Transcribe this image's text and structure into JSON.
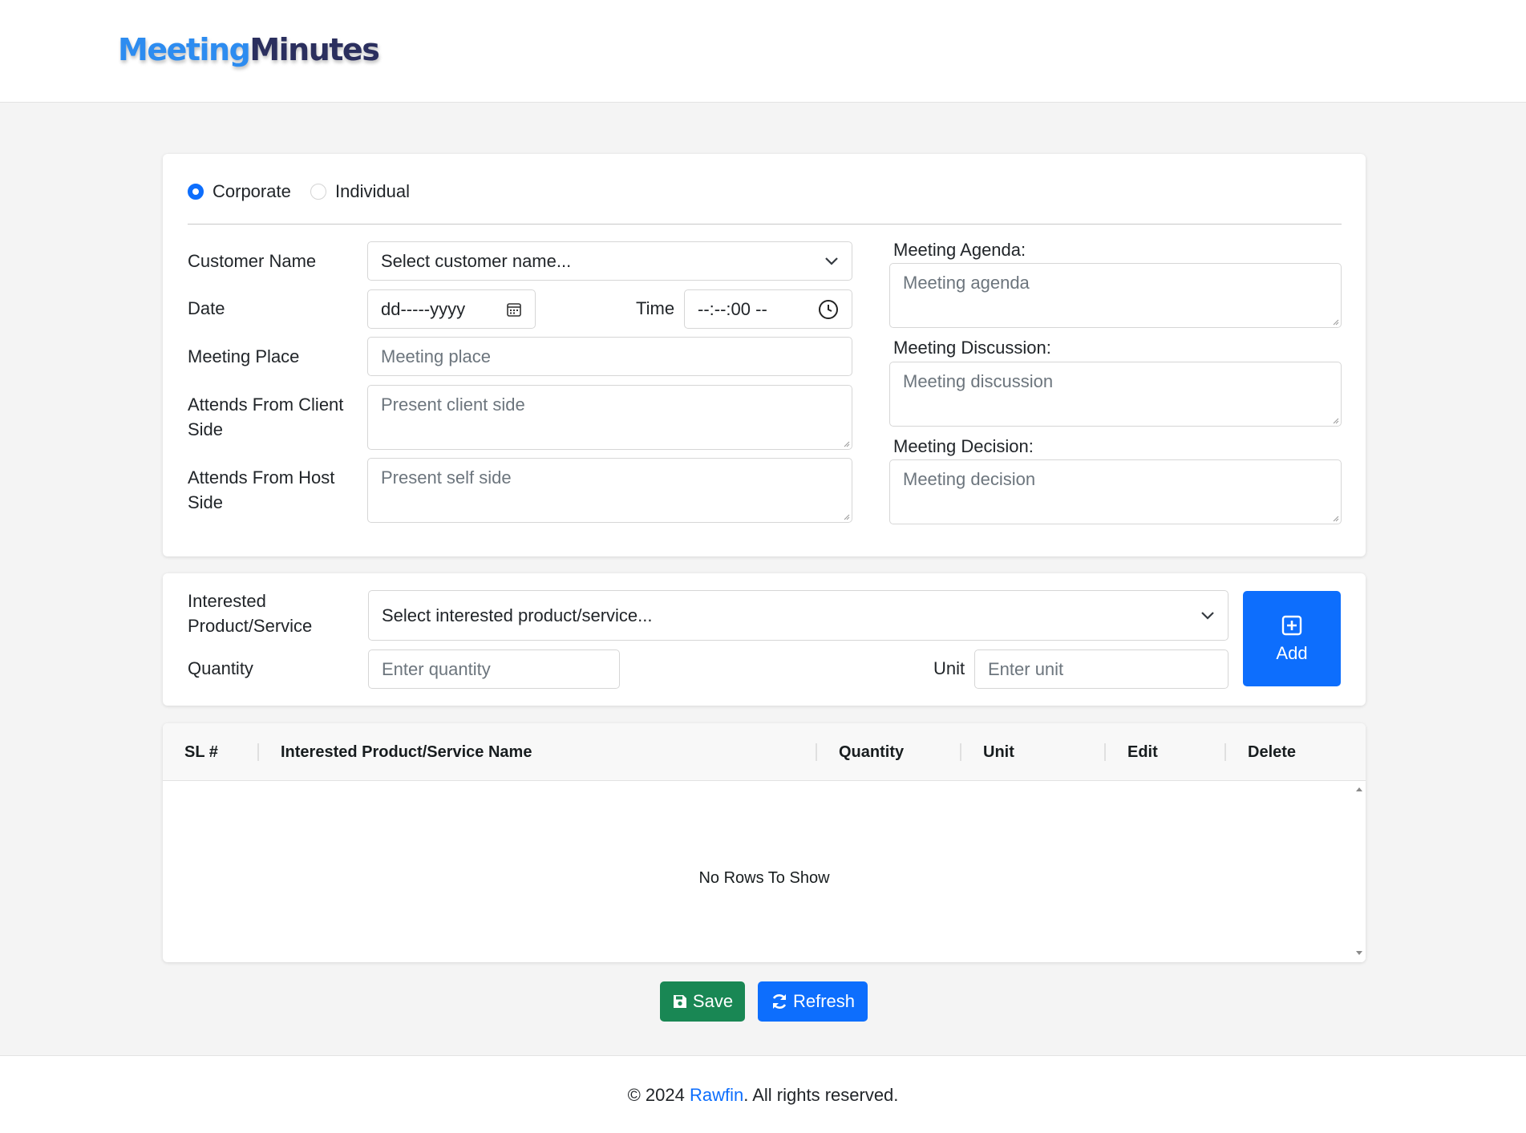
{
  "brand": {
    "part1": "Meeting",
    "part2": "Minutes"
  },
  "customer_type": {
    "options": [
      "Corporate",
      "Individual"
    ],
    "selected": "Corporate"
  },
  "form": {
    "customer_name": {
      "label": "Customer Name",
      "placeholder": "Select customer name..."
    },
    "date": {
      "label": "Date",
      "placeholder": "dd-----yyyy"
    },
    "time": {
      "label": "Time",
      "placeholder": "--:--:00 --"
    },
    "meeting_place": {
      "label": "Meeting Place",
      "placeholder": "Meeting place"
    },
    "client_side": {
      "label": "Attends From Client Side",
      "placeholder": "Present client side"
    },
    "host_side": {
      "label": "Attends From Host Side",
      "placeholder": "Present self side"
    },
    "agenda": {
      "label": "Meeting Agenda:",
      "placeholder": "Meeting agenda"
    },
    "discussion": {
      "label": "Meeting Discussion:",
      "placeholder": "Meeting discussion"
    },
    "decision": {
      "label": "Meeting Decision:",
      "placeholder": "Meeting decision"
    }
  },
  "product": {
    "label": "Interested Product/Service",
    "placeholder": "Select interested product/service...",
    "quantity_label": "Quantity",
    "quantity_placeholder": "Enter quantity",
    "unit_label": "Unit",
    "unit_placeholder": "Enter unit",
    "add_label": "Add"
  },
  "table": {
    "columns": [
      "SL #",
      "Interested Product/Service Name",
      "Quantity",
      "Unit",
      "Edit",
      "Delete"
    ],
    "rows": [],
    "empty_message": "No Rows To Show"
  },
  "actions": {
    "save": "Save",
    "refresh": "Refresh"
  },
  "footer": {
    "prefix": "© 2024 ",
    "link": "Rawfin",
    "suffix": ". All rights reserved."
  },
  "colors": {
    "primary": "#0d6efd",
    "success": "#198754",
    "brand_light": "#2d8cf0",
    "brand_dark": "#2b2f5e"
  },
  "icons": [
    "chevron-down-icon",
    "calendar-icon",
    "clock-icon",
    "plus-square-icon",
    "save-icon",
    "refresh-icon"
  ]
}
